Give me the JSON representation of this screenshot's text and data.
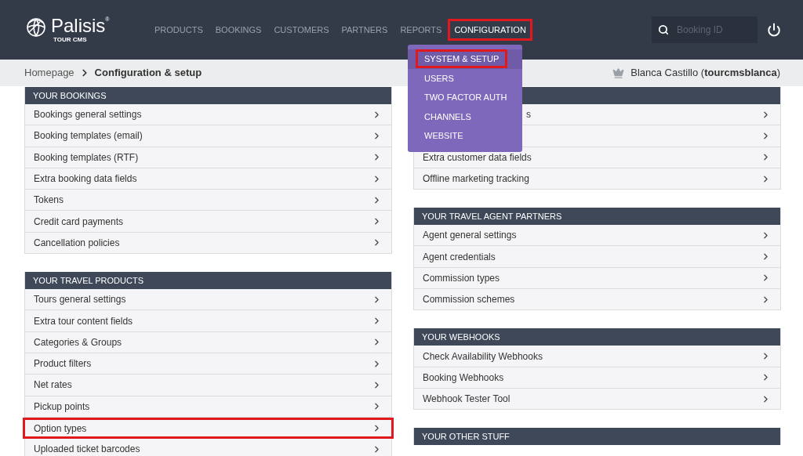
{
  "logo": {
    "name": "Palisis",
    "mark": "®",
    "subtitle": "TOUR CMS"
  },
  "nav": [
    {
      "label": "PRODUCTS",
      "selected": false,
      "highlighted": false
    },
    {
      "label": "BOOKINGS",
      "selected": false,
      "highlighted": false
    },
    {
      "label": "CUSTOMERS",
      "selected": false,
      "highlighted": false
    },
    {
      "label": "PARTNERS",
      "selected": false,
      "highlighted": false
    },
    {
      "label": "REPORTS",
      "selected": false,
      "highlighted": false
    },
    {
      "label": "CONFIGURATION",
      "selected": true,
      "highlighted": true
    }
  ],
  "dropdown": [
    {
      "label": "SYSTEM & SETUP",
      "selected": true,
      "highlighted": true
    },
    {
      "label": "USERS",
      "selected": false,
      "highlighted": false
    },
    {
      "label": "TWO FACTOR AUTH",
      "selected": false,
      "highlighted": false
    },
    {
      "label": "CHANNELS",
      "selected": false,
      "highlighted": false
    },
    {
      "label": "WEBSITE",
      "selected": false,
      "highlighted": false
    }
  ],
  "search": {
    "placeholder": "Booking ID"
  },
  "breadcrumb": {
    "home": "Homepage",
    "current": "Configuration & setup"
  },
  "user": {
    "text": "Blanca Castillo (**tourcmsblanca**)"
  },
  "columns": [
    [
      {
        "title": "YOUR BOOKINGS",
        "rows": [
          {
            "kind": "full",
            "label": "Bookings general settings",
            "highlighted": false
          },
          {
            "kind": "full",
            "label": "Booking templates (email)",
            "highlighted": false
          },
          {
            "kind": "full",
            "label": "Booking templates (RTF)",
            "highlighted": false
          },
          {
            "kind": "full",
            "label": "Extra booking data fields",
            "highlighted": false
          },
          {
            "kind": "full",
            "label": "Tokens",
            "highlighted": false
          },
          {
            "kind": "full",
            "label": "Credit card payments",
            "highlighted": false
          },
          {
            "kind": "full",
            "label": "Cancellation policies",
            "highlighted": false
          }
        ]
      },
      {
        "title": "YOUR TRAVEL PRODUCTS",
        "rows": [
          {
            "kind": "full",
            "label": "Tours general settings",
            "highlighted": false
          },
          {
            "kind": "full",
            "label": "Extra tour content fields",
            "highlighted": false
          },
          {
            "kind": "full",
            "label": "Categories & Groups",
            "highlighted": false
          },
          {
            "kind": "full",
            "label": "Product filters",
            "highlighted": false
          },
          {
            "kind": "full",
            "label": "Net rates",
            "highlighted": false
          },
          {
            "kind": "full",
            "label": "Pickup points",
            "highlighted": false
          },
          {
            "kind": "full",
            "label": "Option types",
            "highlighted": true
          },
          {
            "kind": "full",
            "label": "Uploaded ticket barcodes",
            "highlighted": false
          }
        ]
      }
    ],
    [
      {
        "rows": [
          {
            "kind": "tail",
            "label": "s",
            "highlighted": false
          },
          {
            "kind": "hidden",
            "highlighted": false
          },
          {
            "kind": "full",
            "label": "Extra customer data fields",
            "highlighted": false
          },
          {
            "kind": "full",
            "label": "Offline marketing tracking",
            "highlighted": false
          }
        ]
      },
      {
        "title": "YOUR TRAVEL AGENT PARTNERS",
        "rows": [
          {
            "kind": "full",
            "label": "Agent general settings",
            "highlighted": false
          },
          {
            "kind": "full",
            "label": "Agent credentials",
            "highlighted": false
          },
          {
            "kind": "full",
            "label": "Commission types",
            "highlighted": false
          },
          {
            "kind": "full",
            "label": "Commission schemes",
            "highlighted": false
          }
        ]
      },
      {
        "title": "YOUR WEBHOOKS",
        "rows": [
          {
            "kind": "full",
            "label": "Check Availability Webhooks",
            "highlighted": false
          },
          {
            "kind": "full",
            "label": "Booking Webhooks",
            "highlighted": false
          },
          {
            "kind": "full",
            "label": "Webhook Tester Tool",
            "highlighted": false
          }
        ]
      },
      {
        "title": "YOUR OTHER STUFF"
      }
    ]
  ]
}
